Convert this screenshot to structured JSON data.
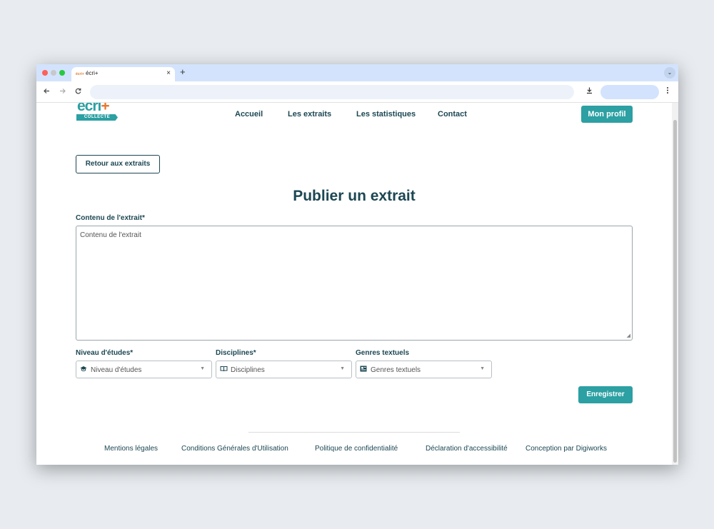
{
  "browser": {
    "tab_title": "écri+",
    "tab_favicon": "écri+",
    "close_glyph": "×",
    "new_tab_glyph": "+",
    "tab_menu_glyph": "⌄",
    "icons": [
      "back-arrow-icon",
      "forward-arrow-icon",
      "reload-icon",
      "download-icon",
      "kebab-menu-icon"
    ]
  },
  "logo": {
    "word": "écri",
    "plus": "+",
    "subtitle": "COLLECTE"
  },
  "nav": {
    "accueil": "Accueil",
    "extraits": "Les extraits",
    "statistiques": "Les statistiques",
    "contact": "Contact",
    "profile_button": "Mon profil"
  },
  "main": {
    "back_button": "Retour aux extraits",
    "title": "Publier un extrait",
    "content_label": "Contenu de l'extrait*",
    "content_placeholder": "Contenu de l'extrait",
    "fields": {
      "niveau": {
        "label": "Niveau d'études*",
        "placeholder": "Niveau d'études",
        "icon": "graduation-cap-icon"
      },
      "disciplines": {
        "label": "Disciplines*",
        "placeholder": "Disciplines",
        "icon": "book-icon"
      },
      "genres": {
        "label": "Genres textuels",
        "placeholder": "Genres textuels",
        "icon": "newspaper-icon"
      }
    },
    "save_button": "Enregistrer"
  },
  "footer": {
    "links": [
      "Mentions légales",
      "Conditions Générales d'Utilisation",
      "Politique de confidentialité",
      "Déclaration d'accessibilité",
      "Conception par Digiworks"
    ]
  },
  "colors": {
    "primary": "#2ca0a3",
    "accent": "#e8762c",
    "text_dark": "#1c4753"
  }
}
